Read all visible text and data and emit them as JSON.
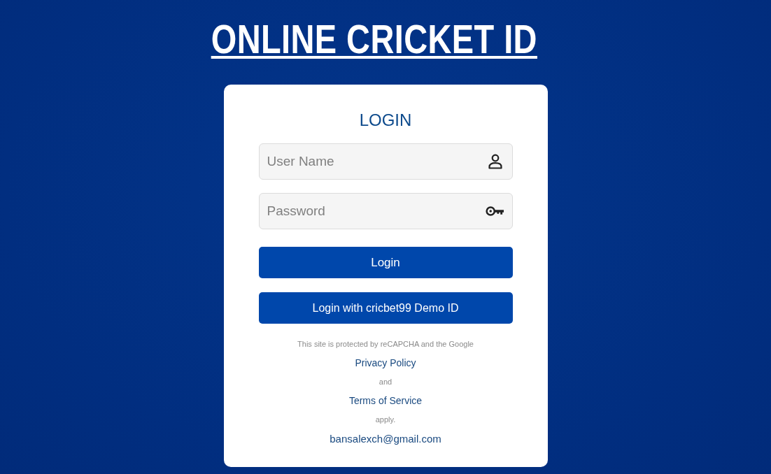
{
  "heading": "ONLINE CRICKET ID",
  "login_form": {
    "title": "LOGIN",
    "fields": [
      {
        "kind": "user",
        "placeholder": "User Name"
      },
      {
        "kind": "password",
        "placeholder": "Password"
      }
    ],
    "buttons": [
      "Login",
      "Login with cricbet99 Demo ID"
    ],
    "notice": [
      {
        "kind": "text",
        "text": "This site is protected by reCAPCHA and the Google"
      },
      {
        "kind": "link",
        "text": "Privacy Policy"
      },
      {
        "kind": "text",
        "text": "and"
      },
      {
        "kind": "link",
        "text": "Terms of Service"
      },
      {
        "kind": "text",
        "text": "apply."
      },
      {
        "kind": "email",
        "text": "bansalexch@gmail.com"
      }
    ]
  }
}
